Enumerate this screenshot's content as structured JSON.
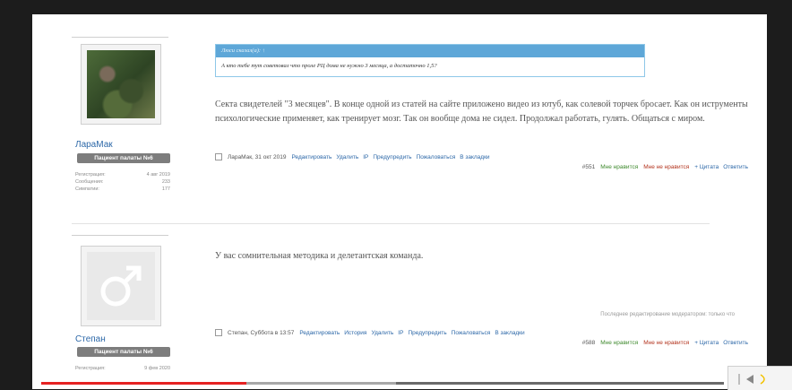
{
  "posts": [
    {
      "username": "ЛараМак",
      "rank": "Пациент палаты №6",
      "stats": [
        {
          "label": "Регистрация:",
          "value": "4 авг 2019"
        },
        {
          "label": "Сообщения:",
          "value": "233"
        },
        {
          "label": "Симпатии:",
          "value": "177"
        }
      ],
      "quote": {
        "author": "Люси сказал(а): ↑",
        "text": "А кто тебе тут советовал что проле РЦ дома не нужно 3 месяца, а достаточно 1,5?"
      },
      "message": "Секта свидетелей \"3 месяцев\". В конце одной из статей на сайте приложено видео из ютуб, как солевой торчек бросает. Как он иструменты психологические применяет, как тренирует мозг. Так он вообще дома не сидел. Продолжал работать, гулять. Общаться с миром.",
      "meta": "ЛараМак, 31 окт 2019",
      "actions": [
        "Редактировать",
        "Удалить",
        "IP",
        "Предупредить",
        "Пожаловаться",
        "В закладки"
      ],
      "number": "#551",
      "like": "Мне нравится",
      "dislike": "Мне не нравится",
      "quote_action": "+ Цитата",
      "reply": "Ответить"
    },
    {
      "username": "Степан",
      "rank": "Пациент палаты №6",
      "stats": [
        {
          "label": "Регистрация:",
          "value": "9 фев 2020"
        }
      ],
      "message": "У вас сомнительная методика и делетантская команда.",
      "edited": "Последнее редактирование модератором: только что",
      "meta": "Степан, Суббота в 13:57",
      "actions": [
        "Редактировать",
        "История",
        "Удалить",
        "IP",
        "Предупредить",
        "Пожаловаться",
        "В закладки"
      ],
      "number": "#588",
      "like": "Мне нравится",
      "dislike": "Мне не нравится",
      "quote_action": "+ Цитата",
      "reply": "Ответить"
    }
  ],
  "video": {
    "played_fraction": 0.3,
    "buffered_fraction": 0.52
  },
  "colors": {
    "link": "#2d68a8",
    "quote_header": "#5ea7d8",
    "progress": "#e52222",
    "like": "#3f8a2e",
    "dislike": "#b3331d"
  }
}
